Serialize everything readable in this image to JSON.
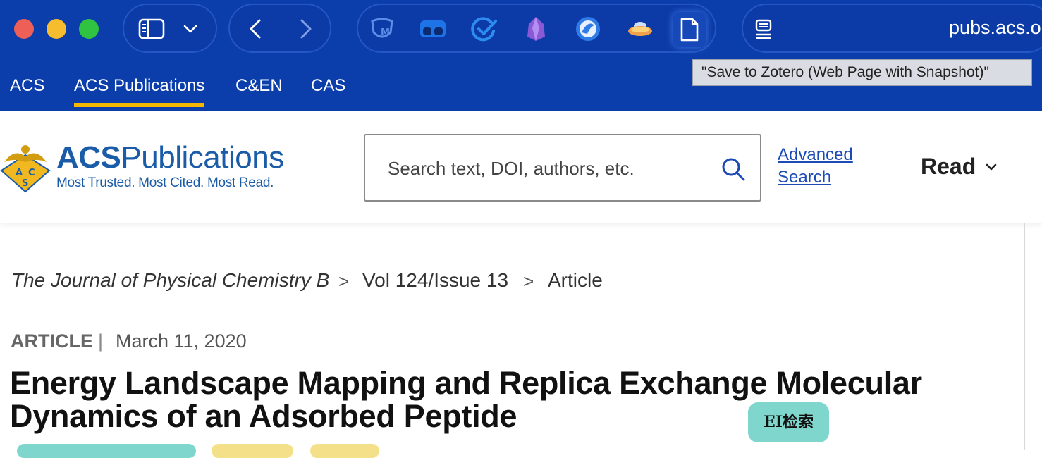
{
  "browser": {
    "url": "pubs.acs.o",
    "tooltip": "\"Save to Zotero (Web Page with Snapshot)\"",
    "icons": {
      "sidebar": "sidebar-icon",
      "dropdown": "chevron-down-icon",
      "back": "back-icon",
      "forward": "forward-icon",
      "extensions": [
        "shield-m-icon",
        "glasses-icon",
        "checkmark-icon",
        "crystal-icon",
        "globe-icon",
        "ufo-icon",
        "page-icon"
      ],
      "reader": "reader-icon"
    }
  },
  "subnav": {
    "items": [
      "ACS",
      "ACS Publications",
      "C&EN",
      "CAS"
    ],
    "active_index": 1
  },
  "header": {
    "logo_title_bold": "ACS",
    "logo_title_rest": "Publications",
    "logo_tagline": "Most Trusted. Most Cited. Most Read.",
    "logo_emblem_letters": [
      "A",
      "C",
      "S"
    ],
    "search_placeholder": "Search text, DOI, authors, etc.",
    "advanced_line1": "Advanced",
    "advanced_line2": "Search",
    "read_label": "Read"
  },
  "breadcrumb": {
    "journal": "The Journal of Physical Chemistry B",
    "sep1": ">",
    "issue": "Vol 124/Issue 13",
    "sep2": ">",
    "current": "Article"
  },
  "article": {
    "type": "ARTICLE",
    "divider": "|",
    "date": "March 11, 2020",
    "title_line1": "Energy Landscape Mapping and Replica Exchange Molecular",
    "title_line2": "Dynamics of an Adsorbed Peptide"
  },
  "badge": {
    "label": "EI检索"
  },
  "colors": {
    "chrome_bg": "#0b3eaa",
    "accent_underline": "#f5b800",
    "brand_blue": "#1b5ca8",
    "link": "#1c4bb5",
    "badge_bg": "#7fd6cd"
  }
}
